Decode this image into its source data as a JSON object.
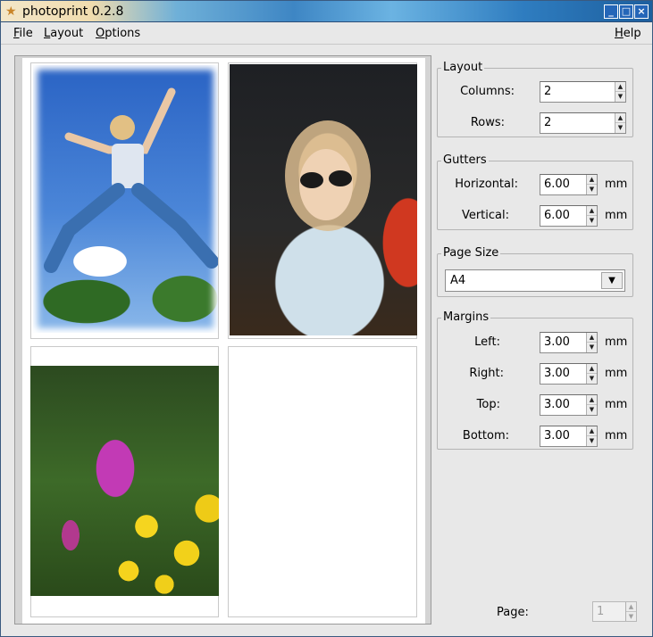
{
  "window": {
    "title": "photoprint 0.2.8",
    "app_icon": "star-icon",
    "controls": {
      "minimize": "_",
      "maximize": "□",
      "close": "×"
    }
  },
  "menubar": {
    "items": [
      {
        "accel": "F",
        "rest": "ile"
      },
      {
        "accel": "L",
        "rest": "ayout"
      },
      {
        "accel": "O",
        "rest": "ptions"
      }
    ],
    "help": {
      "accel": "H",
      "rest": "elp"
    }
  },
  "preview": {
    "cells": [
      {
        "image": "girl jumping against blue sky"
      },
      {
        "image": "girl with sunglasses"
      },
      {
        "image": "pink and yellow flowers"
      },
      {
        "image": ""
      }
    ]
  },
  "layout": {
    "title": "Layout",
    "columns_label": "Columns:",
    "columns_value": "2",
    "rows_label": "Rows:",
    "rows_value": "2"
  },
  "gutters": {
    "title": "Gutters",
    "horizontal_label": "Horizontal:",
    "horizontal_value": "6.00",
    "vertical_label": "Vertical:",
    "vertical_value": "6.00",
    "unit": "mm"
  },
  "page_size": {
    "title": "Page Size",
    "value": "A4"
  },
  "margins": {
    "title": "Margins",
    "left_label": "Left:",
    "left_value": "3.00",
    "right_label": "Right:",
    "right_value": "3.00",
    "top_label": "Top:",
    "top_value": "3.00",
    "bottom_label": "Bottom:",
    "bottom_value": "3.00",
    "unit": "mm"
  },
  "page": {
    "label": "Page:",
    "value": "1"
  }
}
